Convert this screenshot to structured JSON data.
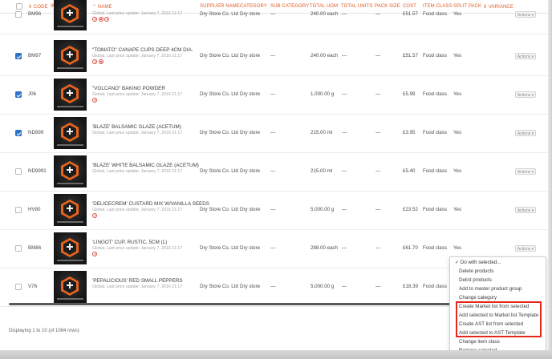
{
  "header": {
    "code": "⇕ CODE",
    "image": "IMAGE",
    "name": "⌃ NAME",
    "supplier": "SUPPLIER NAME",
    "category": "CATEGORY",
    "subcategory": "SUB CATEGORY",
    "total_uom": "TOTAL UOM",
    "total_units": "TOTAL UNITS",
    "pack_size": "PACK SIZE",
    "cost": "COST",
    "item_class": "ITEM CLASS",
    "split_pack": "SPLIT PACK",
    "variance": "⇕ VARIANCE"
  },
  "rows": [
    {
      "code": "BM96",
      "name": "",
      "meta": "Global, Last price update: January 7, 2016 21:17",
      "supplier": "Dry Store Co. Ltd",
      "category": "Dry store",
      "subcategory": "—",
      "total_uom": "240.00 each",
      "total_units": "—",
      "pack_size": "—",
      "cost": "£51.57",
      "item_class": "Food class",
      "split_pack": "Yes",
      "actions": "Actions ▾",
      "checked": false,
      "allergens": 3
    },
    {
      "code": "BM97",
      "name": "\"TOMATO\" CANAPE CUPS DEEP 4CM DIA.",
      "meta": "Global, Last price update: January 7, 2016 21:17",
      "supplier": "Dry Store Co. Ltd",
      "category": "Dry store",
      "subcategory": "—",
      "total_uom": "240.00 each",
      "total_units": "—",
      "pack_size": "—",
      "cost": "£51.57",
      "item_class": "Food class",
      "split_pack": "Yes",
      "actions": "Actions ▾",
      "checked": true,
      "allergens": 2
    },
    {
      "code": "J06",
      "name": "\"VOLCANO\" BAKING POWDER",
      "meta": "Global, Last price update: January 7, 2016 21:17",
      "supplier": "Dry Store Co. Ltd",
      "category": "Dry store",
      "subcategory": "—",
      "total_uom": "1,000.00 g",
      "total_units": "—",
      "pack_size": "—",
      "cost": "£5.99",
      "item_class": "Food class",
      "split_pack": "Yes",
      "actions": "Actions ▾",
      "checked": true,
      "allergens": 1
    },
    {
      "code": "ND999",
      "name": "'BLAZE' BALSAMIC GLAZE (ACETUM)",
      "meta": "Global, Last price update: January 7, 2016 21:17",
      "supplier": "Dry Store Co. Ltd",
      "category": "Dry store",
      "subcategory": "—",
      "total_uom": "215.00 ml",
      "total_units": "—",
      "pack_size": "—",
      "cost": "£3.95",
      "item_class": "Food class",
      "split_pack": "Yes",
      "actions": "Actions ▾",
      "checked": true,
      "allergens": 0
    },
    {
      "code": "ND9991",
      "name": "'BLAZE' WHITE BALSAMIC GLAZE (ACETUM)",
      "meta": "Global, Last price update: January 7, 2016 21:17",
      "supplier": "Dry Store Co. Ltd",
      "category": "Dry store",
      "subcategory": "—",
      "total_uom": "215.00 ml",
      "total_units": "—",
      "pack_size": "—",
      "cost": "£5.40",
      "item_class": "Food class",
      "split_pack": "Yes",
      "actions": "Actions ▾",
      "checked": false,
      "allergens": 0
    },
    {
      "code": "HV80",
      "name": "'DELICECREM' CUSTARD MIX W/VANILLA SEEDS",
      "meta": "Global, Last price update: January 7, 2016 21:17",
      "supplier": "Dry Store Co. Ltd",
      "category": "Dry store",
      "subcategory": "—",
      "total_uom": "5,000.00 g",
      "total_units": "—",
      "pack_size": "—",
      "cost": "£23.52",
      "item_class": "Food class",
      "split_pack": "Yes",
      "actions": "Actions ▾",
      "checked": false,
      "allergens": 1
    },
    {
      "code": "BM86",
      "name": "'LINGOT' CUP, RUSTIC, 5CM (L)",
      "meta": "Global, Last price update: January 7, 2016 21:17",
      "supplier": "Dry Store Co. Ltd",
      "category": "Dry store",
      "subcategory": "—",
      "total_uom": "288.00 each",
      "total_units": "—",
      "pack_size": "—",
      "cost": "£61.70",
      "item_class": "Food class",
      "split_pack": "Yes",
      "actions": "Actions ▾",
      "checked": false,
      "allergens": 1
    },
    {
      "code": "V76",
      "name": "'PEPALICIOUS' RED SMALL PEPPERS",
      "meta": "Global, Last price update: January 7, 2016 21:17",
      "supplier": "Dry Store Co. Ltd",
      "category": "Dry store",
      "subcategory": "—",
      "total_uom": "5,000.00 g",
      "total_units": "—",
      "pack_size": "—",
      "cost": "£18.39",
      "item_class": "Food class",
      "split_pack": "Yes",
      "actions": "",
      "checked": false,
      "allergens": 0
    }
  ],
  "footer": {
    "displaying": "Displaying 1 to 10 (of 1064 rows)"
  },
  "dropdown": {
    "items": [
      "✓ Do with selected...",
      "Delete products",
      "Delist products",
      "Add to master product group",
      "Change category",
      "Create Market list from selected",
      "Add selected to Market list Template",
      "Create AST list from selected",
      "Add selected to AST Template",
      "Change item class",
      "Replace selected"
    ]
  },
  "colors": {
    "accent": "#e05a23",
    "checkbox": "#2d73c6",
    "highlight": "#e8261c"
  }
}
